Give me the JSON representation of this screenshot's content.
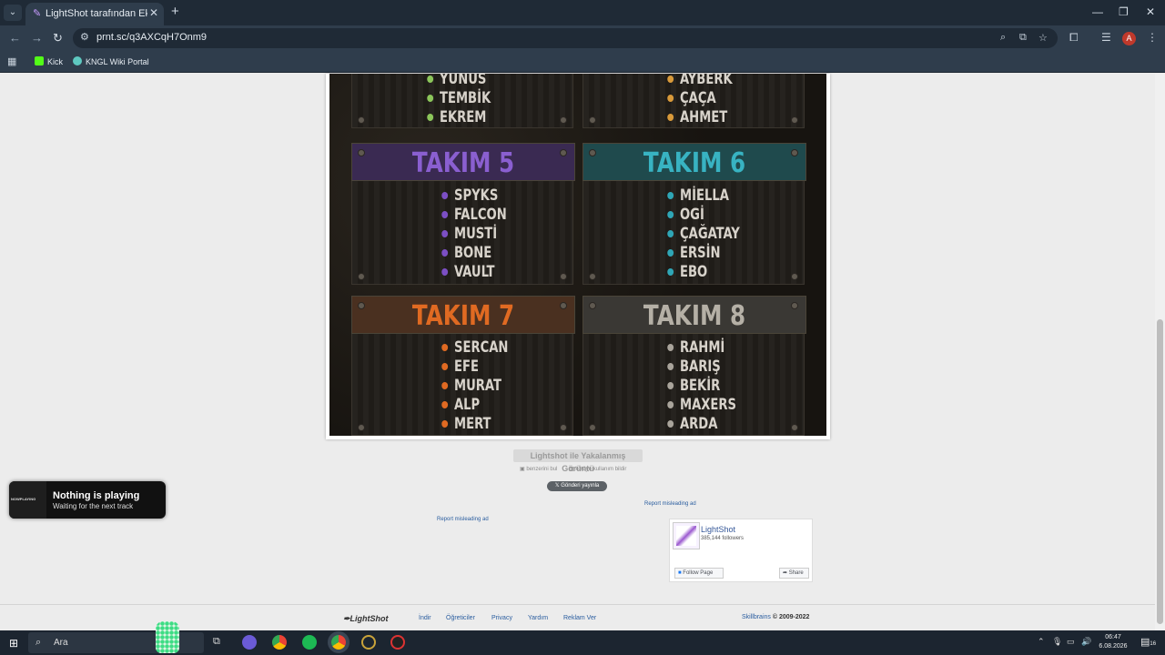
{
  "browser": {
    "tab_title": "LightShot tarafından Ekran Görüntüsü",
    "url": "prnt.sc/q3AXCqH7Onm9",
    "bookmarks": [
      "Kick",
      "KNGL Wiki Portal"
    ],
    "avatar_letter": "A"
  },
  "teams": [
    {
      "name": "",
      "color": "#8cc65a",
      "players": [
        "YUNUS",
        "TEMBİK",
        "EKREM"
      ]
    },
    {
      "name": "",
      "color": "#d99a3a",
      "players": [
        "AYBERK",
        "ÇAÇA",
        "AHMET"
      ]
    },
    {
      "name": "TAKIM 5",
      "color": "#7c4fc4",
      "banner": "#3a2a52",
      "players": [
        "SPYKS",
        "FALCON",
        "MUSTİ",
        "BONE",
        "VAULT"
      ]
    },
    {
      "name": "TAKIM 6",
      "color": "#2fa6b6",
      "banner": "#1f4a4d",
      "players": [
        "MİELLA",
        "OGİ",
        "ÇAĞATAY",
        "ERSİN",
        "EBO"
      ]
    },
    {
      "name": "TAKIM 7",
      "color": "#e06a22",
      "banner": "#4a3020",
      "players": [
        "SERCAN",
        "EFE",
        "MURAT",
        "ALP",
        "MERT"
      ]
    },
    {
      "name": "TAKIM 8",
      "color": "#a9a49b",
      "banner": "#3a3834",
      "players": [
        "RAHMİ",
        "BARIŞ",
        "BEKİR",
        "MAXERS",
        "ARDA"
      ]
    }
  ],
  "page": {
    "caption": "Lightshot ile Yakalanmış Görüntü",
    "similar": "benzerini bul",
    "report_user": "kötüye kullanım bildir",
    "tweet": "Gönderi yayınla",
    "report_ad": "Report misleading ad"
  },
  "facebook": {
    "name": "LightShot",
    "followers": "385,144 followers",
    "follow": "Follow Page",
    "share": "Share"
  },
  "footer": {
    "logo": "LightShot",
    "links": [
      "İndir",
      "Öğreticiler",
      "Privacy",
      "Yardım",
      "Reklam Ver"
    ],
    "company": "Skillbrains",
    "copyright": " © 2009-2022"
  },
  "music": {
    "brand": "NOWPLAYING",
    "title": "Nothing is playing",
    "subtitle": "Waiting for the next track"
  },
  "taskbar": {
    "search_placeholder": "Ara",
    "time": "06:47",
    "date": "6.08.2026",
    "notifications": "16"
  }
}
